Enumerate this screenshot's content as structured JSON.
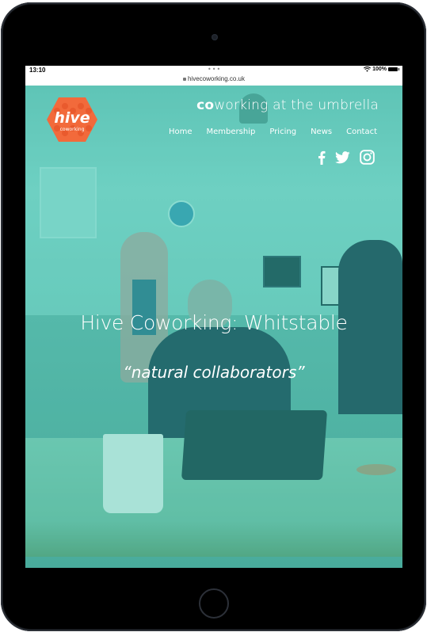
{
  "device": {
    "type": "tablet"
  },
  "statusbar": {
    "time": "13:10",
    "dots": "•••",
    "battery": "100%"
  },
  "browser": {
    "url": "hivecoworking.co.uk"
  },
  "header": {
    "logo": {
      "word": "hive",
      "subword": "coworking",
      "color": "#f26a3b"
    },
    "tagline_bold": "co",
    "tagline_rest": "working at the umbrella",
    "nav": [
      {
        "label": "Home"
      },
      {
        "label": "Membership"
      },
      {
        "label": "Pricing"
      },
      {
        "label": "News"
      },
      {
        "label": "Contact"
      }
    ],
    "social": [
      "facebook-icon",
      "twitter-icon",
      "instagram-icon"
    ]
  },
  "hero": {
    "title": "Hive Coworking: Whitstable",
    "quote": "“natural collaborators”",
    "overlay_color": "#3fbfaa"
  }
}
